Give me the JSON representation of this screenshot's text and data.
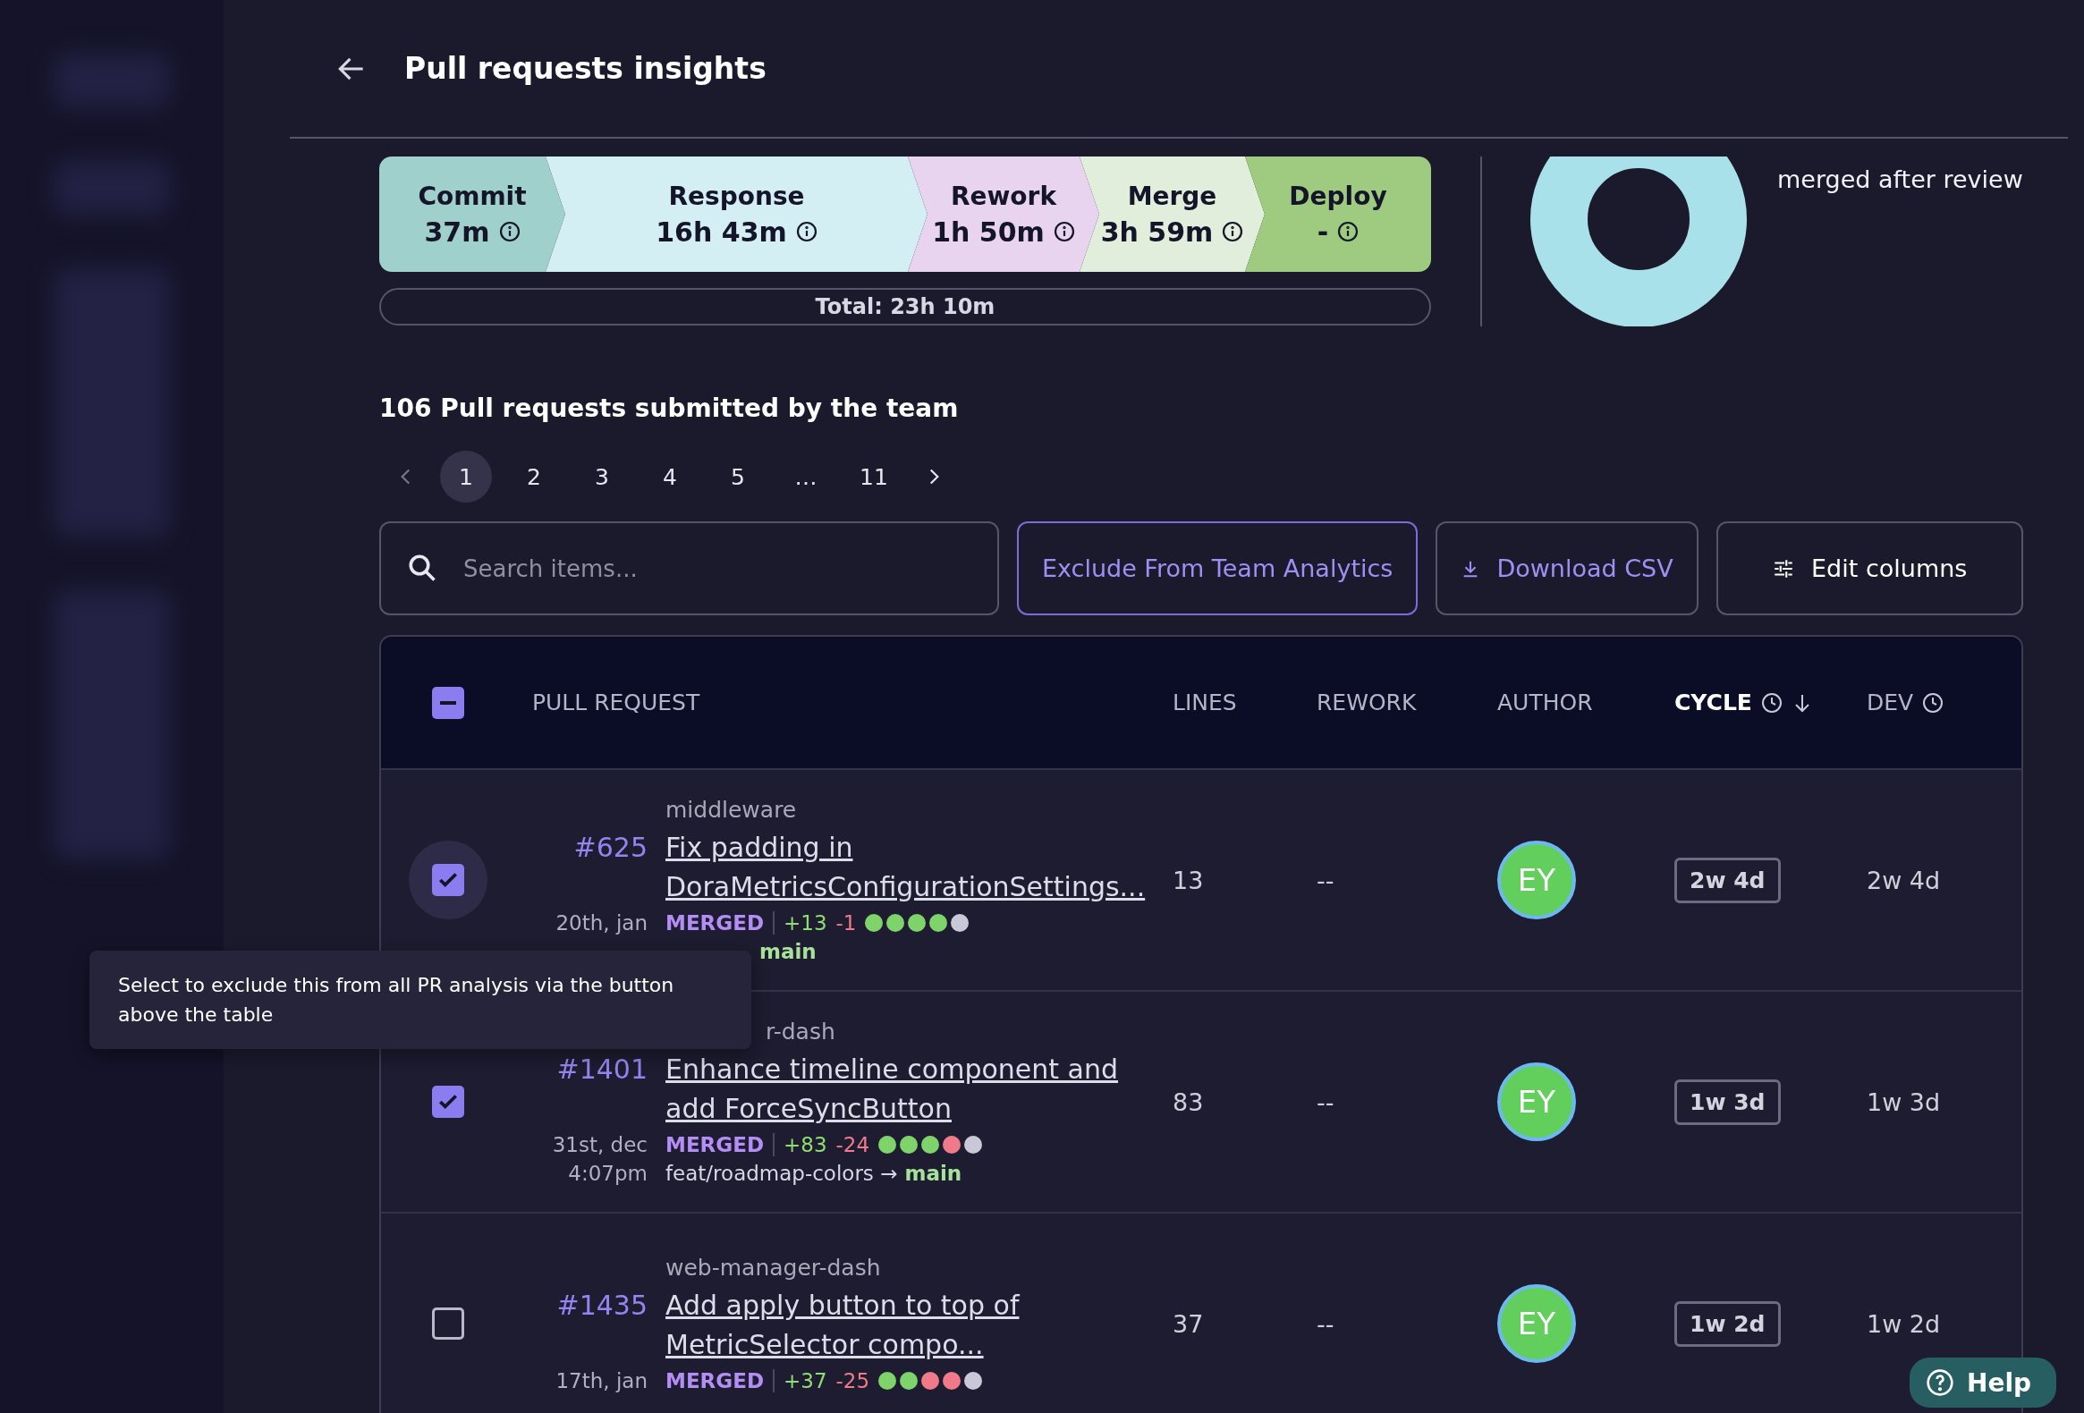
{
  "header": {
    "title": "Pull requests insights"
  },
  "stages": [
    {
      "kind": "commit",
      "label": "Commit",
      "value": "37m",
      "color": "#9fd0cc"
    },
    {
      "kind": "response",
      "label": "Response",
      "value": "16h 43m",
      "color": "#d3eff4"
    },
    {
      "kind": "rework",
      "label": "Rework",
      "value": "1h 50m",
      "color": "#e8d4ef"
    },
    {
      "kind": "merge",
      "label": "Merge",
      "value": "3h 59m",
      "color": "#e1eedc"
    },
    {
      "kind": "deploy",
      "label": "Deploy",
      "value": "-",
      "color": "#9ecb80"
    }
  ],
  "total": "Total: 23h 10m",
  "donut_caption": "merged after review",
  "section_title": "106 Pull requests submitted by the team",
  "pagination": [
    {
      "label": "1",
      "selected": true
    },
    {
      "label": "2",
      "selected": false
    },
    {
      "label": "3",
      "selected": false
    },
    {
      "label": "4",
      "selected": false
    },
    {
      "label": "5",
      "selected": false
    },
    {
      "label": "…",
      "selected": false
    },
    {
      "label": "11",
      "selected": false
    }
  ],
  "search": {
    "placeholder": "Search items..."
  },
  "buttons": [
    {
      "kind": "exclude",
      "label": "Exclude From Team Analytics"
    },
    {
      "kind": "download",
      "label": "Download CSV"
    },
    {
      "kind": "edit",
      "label": "Edit columns"
    }
  ],
  "table": {
    "select_all_partial": true,
    "columns": [
      {
        "label": "PULL REQUEST",
        "active": false,
        "kind": "plain"
      },
      {
        "label": "LINES",
        "active": false,
        "kind": "plain"
      },
      {
        "label": "REWORK",
        "active": false,
        "kind": "plain"
      },
      {
        "label": "AUTHOR",
        "active": false,
        "kind": "plain"
      },
      {
        "label": "CYCLE",
        "active": true,
        "kind": "timed"
      },
      {
        "label": "DEV",
        "active": false,
        "kind": "timed"
      }
    ],
    "rows": [
      {
        "checked": true,
        "hovered": true,
        "repo": "middleware",
        "number": "#625",
        "title": "Fix padding in DoraMetricsConfigurationSettings...",
        "date": "20th, jan",
        "status": "MERGED",
        "added": "+13",
        "removed": "-1",
        "checks": [
          {
            "color": "#7ed36a"
          },
          {
            "color": "#7ed36a"
          },
          {
            "color": "#7ed36a"
          },
          {
            "color": "#7ed36a"
          },
          {
            "color": "#c8c8d8"
          }
        ],
        "branch_covered": true,
        "target": "main",
        "lines": "13",
        "rework": "--",
        "author": "EY",
        "cycle": "2w 4d",
        "dev": "2w 4d"
      },
      {
        "checked": true,
        "hovered": false,
        "repo": "r-dash",
        "repo_covered": true,
        "number": "#1401",
        "title": "Enhance timeline component and add ForceSyncButton",
        "date": "31st, dec",
        "time": "4:07pm",
        "status": "MERGED",
        "added": "+83",
        "removed": "-24",
        "checks": [
          {
            "color": "#7ed36a"
          },
          {
            "color": "#7ed36a"
          },
          {
            "color": "#7ed36a"
          },
          {
            "color": "#f07a8a"
          },
          {
            "color": "#c8c8d8"
          }
        ],
        "source": "feat/roadmap-colors →",
        "target": "main",
        "lines": "83",
        "rework": "--",
        "author": "EY",
        "cycle": "1w 3d",
        "dev": "1w 3d"
      },
      {
        "checked": false,
        "hovered": false,
        "repo": "web-manager-dash",
        "number": "#1435",
        "title": "Add apply button to top of MetricSelector compo...",
        "date": "17th, jan",
        "status": "MERGED",
        "added": "+37",
        "removed": "-25",
        "checks": [
          {
            "color": "#7ed36a"
          },
          {
            "color": "#7ed36a"
          },
          {
            "color": "#f07a8a"
          },
          {
            "color": "#f07a8a"
          },
          {
            "color": "#c8c8d8"
          }
        ],
        "lines": "37",
        "rework": "--",
        "author": "EY",
        "cycle": "1w 2d",
        "dev": "1w 2d"
      }
    ]
  },
  "tooltip": "Select to exclude this from all PR analysis via the button above the table",
  "help": "Help"
}
